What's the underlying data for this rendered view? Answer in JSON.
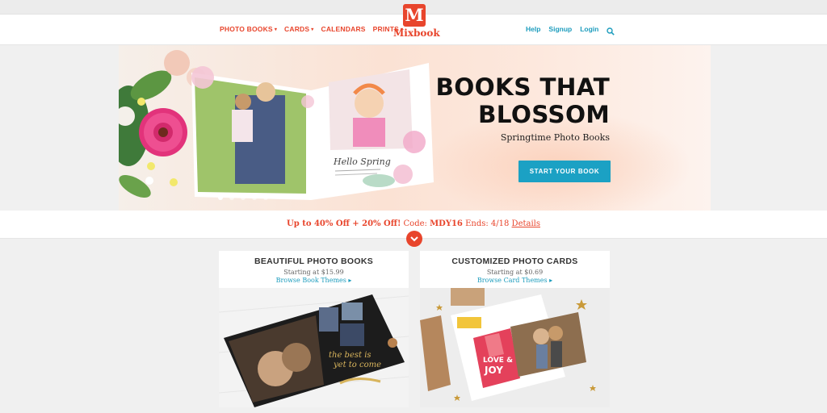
{
  "nav": {
    "items": [
      {
        "label": "PHOTO BOOKS",
        "dropdown": true
      },
      {
        "label": "CARDS",
        "dropdown": true
      },
      {
        "label": "CALENDARS",
        "dropdown": false
      },
      {
        "label": "PRINTS",
        "dropdown": true
      }
    ],
    "caret": "▾",
    "logo_letter": "M",
    "logo_text": "Mixbook",
    "right": {
      "help": "Help",
      "signup": "Signup",
      "login": "Login",
      "search_icon": "search-icon"
    }
  },
  "hero": {
    "headline_line1": "BOOKS THAT",
    "headline_line2": "BLOSSOM",
    "subtitle": "Springtime Photo Books",
    "cta": "START YOUR BOOK",
    "book_caption": "Hello Spring",
    "slides": 5,
    "active_slide": 0
  },
  "promo": {
    "offer": "Up to 40% Off + 20% Off!",
    "code_label": "Code:",
    "code": "MDY16",
    "ends": "Ends: 4/18",
    "details": "Details"
  },
  "cards": [
    {
      "title": "BEAUTIFUL PHOTO BOOKS",
      "price": "Starting at $15.99",
      "link": "Browse Book Themes ▸"
    },
    {
      "title": "CUSTOMIZED PHOTO CARDS",
      "price": "Starting at $0.69",
      "link": "Browse Card Themes ▸"
    }
  ],
  "colors": {
    "brand": "#e8452c",
    "accent": "#1ba1c4",
    "link": "#1c9cbd"
  }
}
